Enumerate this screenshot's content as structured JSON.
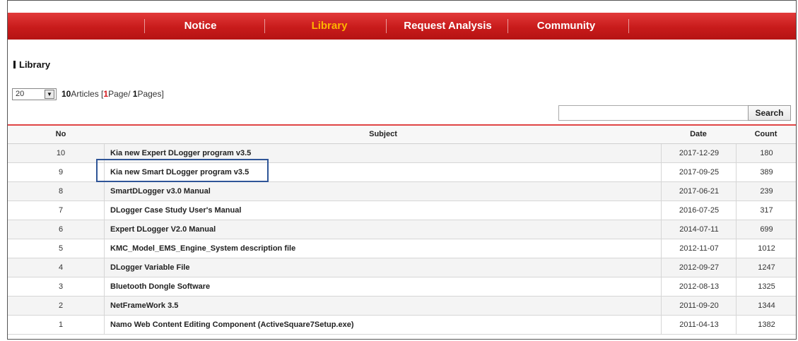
{
  "nav": {
    "items": [
      {
        "label": "Notice",
        "active": false
      },
      {
        "label": "Library",
        "active": true
      },
      {
        "label": "Request Analysis",
        "active": false
      },
      {
        "label": "Community",
        "active": false
      }
    ],
    "accent_color": "#c81b1b",
    "active_color": "#ffb300"
  },
  "section": {
    "title": "Library"
  },
  "list_controls": {
    "page_size": "20",
    "article_count": "10",
    "articles_label": "Articles",
    "current_page": "1",
    "page_label": "Page/ ",
    "total_pages": "1",
    "pages_label": "Pages"
  },
  "search": {
    "value": "",
    "button_label": "Search"
  },
  "table": {
    "headers": {
      "no": "No",
      "subject": "Subject",
      "date": "Date",
      "count": "Count"
    },
    "rows": [
      {
        "no": "10",
        "subject": "Kia new Expert DLogger program v3.5",
        "date": "2017-12-29",
        "count": "180"
      },
      {
        "no": "9",
        "subject": "Kia new Smart DLogger program v3.5",
        "date": "2017-09-25",
        "count": "389"
      },
      {
        "no": "8",
        "subject": "SmartDLogger v3.0 Manual",
        "date": "2017-06-21",
        "count": "239"
      },
      {
        "no": "7",
        "subject": "DLogger Case Study User's Manual",
        "date": "2016-07-25",
        "count": "317"
      },
      {
        "no": "6",
        "subject": "Expert DLogger V2.0 Manual",
        "date": "2014-07-11",
        "count": "699"
      },
      {
        "no": "5",
        "subject": "KMC_Model_EMS_Engine_System description file",
        "date": "2012-11-07",
        "count": "1012"
      },
      {
        "no": "4",
        "subject": "DLogger Variable File",
        "date": "2012-09-27",
        "count": "1247"
      },
      {
        "no": "3",
        "subject": "Bluetooth Dongle Software",
        "date": "2012-08-13",
        "count": "1325"
      },
      {
        "no": "2",
        "subject": "NetFrameWork 3.5",
        "date": "2011-09-20",
        "count": "1344"
      },
      {
        "no": "1",
        "subject": "Namo Web Content Editing Component (ActiveSquare7Setup.exe)",
        "date": "2011-04-13",
        "count": "1382"
      }
    ]
  }
}
